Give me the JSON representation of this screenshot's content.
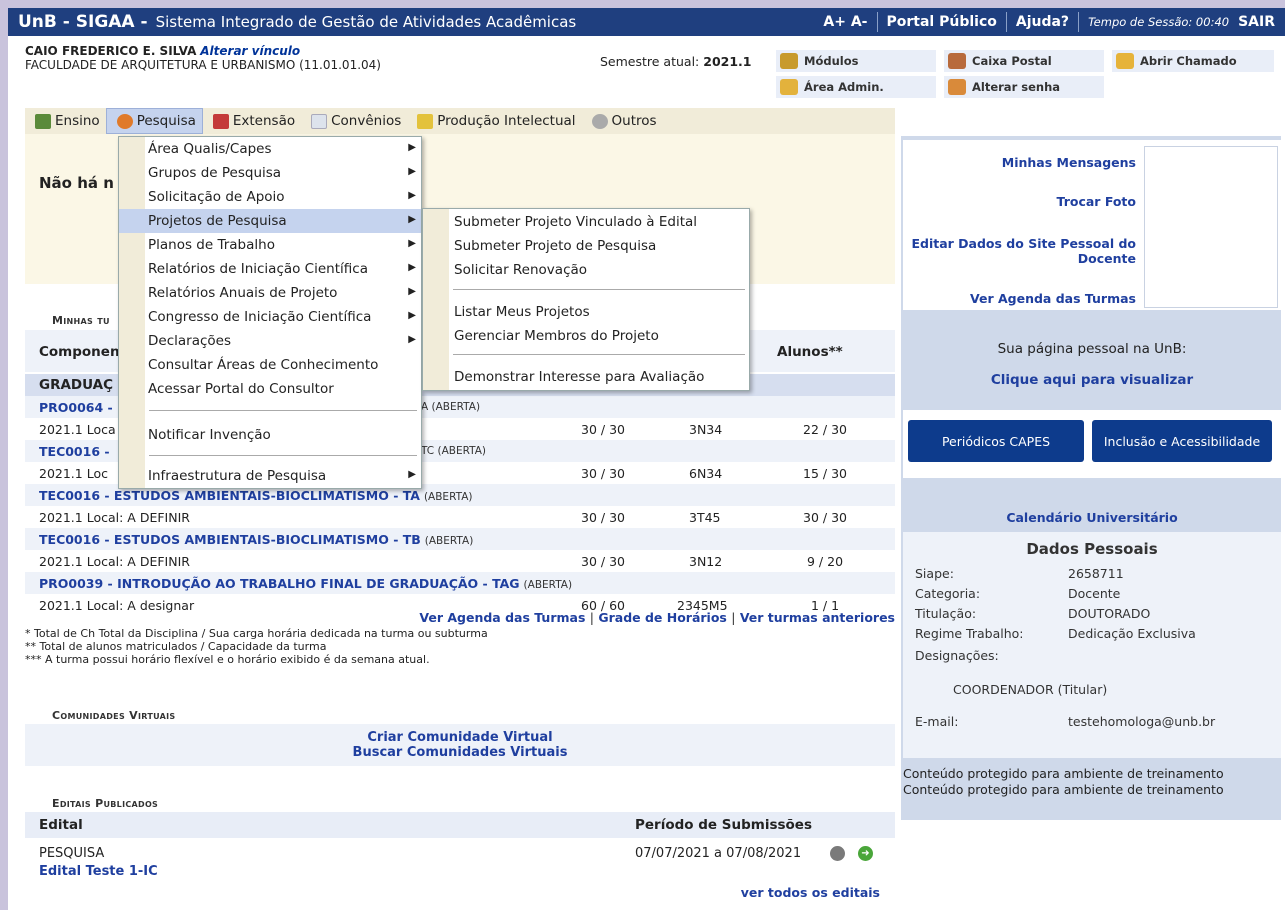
{
  "topbar": {
    "brand": "UnB - SIGAA -",
    "system_name": "Sistema Integrado de Gestão de Atividades Acadêmicas",
    "font_size": "A+ A-",
    "portal": "Portal Público",
    "help": "Ajuda?",
    "session_label": "Tempo de Sessão: 00:40",
    "logout": "SAIR"
  },
  "user": {
    "name": "CAIO FREDERICO E. SILVA",
    "change_link": "Alterar vínculo",
    "unit": "FACULDADE DE ARQUITETURA E URBANISMO (11.01.01.04)"
  },
  "semester": {
    "label": "Semestre atual:",
    "value": "2021.1"
  },
  "shortcuts": {
    "modulos": "Módulos",
    "caixa": "Caixa Postal",
    "chamado": "Abrir Chamado",
    "admin": "Área Admin.",
    "senha": "Alterar senha"
  },
  "menu": [
    "Ensino",
    "Pesquisa",
    "Extensão",
    "Convênios",
    "Produção Intelectual",
    "Outros"
  ],
  "dropdown": {
    "items": [
      "Área Qualis/Capes",
      "Grupos de Pesquisa",
      "Solicitação de Apoio",
      "Projetos de Pesquisa",
      "Planos de Trabalho",
      "Relatórios de Iniciação Científica",
      "Relatórios Anuais de Projeto",
      "Congresso de Iniciação Científica",
      "Declarações",
      "Consultar Áreas de Conhecimento",
      "Acessar Portal do Consultor",
      "Notificar Invenção",
      "Infraestrutura de Pesquisa"
    ],
    "submenu": [
      "Submeter Projeto Vinculado à Edital",
      "Submeter Projeto de Pesquisa",
      "Solicitar Renovação",
      "Listar Meus Projetos",
      "Gerenciar Membros do Projeto",
      "Demonstrar Interesse para Avaliação"
    ]
  },
  "notice": "Não há n",
  "turmas": {
    "title": "Minhas tu",
    "header_comp": "Componen",
    "header_alunos": "Alunos**",
    "group": "GRADUAÇ",
    "rows": [
      {
        "code": "PRO0064 -",
        "status": "A (ABERTA)",
        "local": "2021.1 Loca",
        "ch": "30 / 30",
        "hor": "3N34",
        "al": "22 / 30"
      },
      {
        "code": "TEC0016 -",
        "status": "TC (ABERTA)",
        "local": "2021.1 Loc",
        "ch": "30 / 30",
        "hor": "6N34",
        "al": "15 / 30"
      },
      {
        "code": "TEC0016 - ESTUDOS AMBIENTAIS-BIOCLIMATISMO - TA",
        "status": "(ABERTA)",
        "local": "2021.1 Local: A DEFINIR",
        "ch": "30 / 30",
        "hor": "3T45",
        "al": "30 / 30"
      },
      {
        "code": "TEC0016 - ESTUDOS AMBIENTAIS-BIOCLIMATISMO - TB",
        "status": "(ABERTA)",
        "local": "2021.1 Local: A DEFINIR",
        "ch": "30 / 30",
        "hor": "3N12",
        "al": "9 / 20"
      },
      {
        "code": "PRO0039 - INTRODUÇÃO AO TRABALHO FINAL DE GRADUAÇÃO - TAG",
        "status": "(ABERTA)",
        "local": "2021.1 Local: A designar",
        "ch": "60 / 60",
        "hor": "2345M5",
        "al": "1 / 1"
      }
    ],
    "links": [
      "Ver Agenda das Turmas",
      "Grade de Horários",
      "Ver turmas anteriores"
    ],
    "notes": [
      "* Total de Ch Total da Disciplina / Sua carga horária dedicada na turma ou subturma",
      "** Total de alunos matriculados / Capacidade da turma",
      "*** A turma possui horário flexível e o horário exibido é da semana atual."
    ]
  },
  "comunidades": {
    "title": "Comunidades Virtuais",
    "create": "Criar Comunidade Virtual",
    "search": "Buscar Comunidades Virtuais"
  },
  "editais": {
    "title": "Editais Publicados",
    "col_edital": "Edital",
    "col_periodo": "Período de Submissões",
    "item_type": "PESQUISA",
    "item_name": "Edital Teste 1-IC",
    "item_period": "07/07/2021 a 07/08/2021",
    "see_all": "ver todos os editais"
  },
  "side": {
    "mensagens": "Minhas Mensagens",
    "foto": "Trocar Foto",
    "site": "Editar Dados do Site Pessoal do Docente",
    "agenda": "Ver Agenda das Turmas",
    "personal_page": "Sua página pessoal na UnB:",
    "personal_link": "Clique aqui para visualizar",
    "capes": "Periódicos CAPES",
    "acess": "Inclusão e Acessibilidade",
    "calendario": "Calendário Universitário",
    "dados_title": "Dados Pessoais",
    "siape_l": "Siape:",
    "siape_v": "2658711",
    "cat_l": "Categoria:",
    "cat_v": "Docente",
    "tit_l": "Titulação:",
    "tit_v": "DOUTORADO",
    "reg_l": "Regime Trabalho:",
    "reg_v": "Dedicação Exclusiva",
    "des_l": "Designações:",
    "des_v": "COORDENADOR (Titular)",
    "email_l": "E-mail:",
    "email_v": "testehomologa@unb.br",
    "protect1": "Conteúdo protegido para ambiente de treinamento",
    "protect2": "Conteúdo protegido para ambiente de treinamento"
  }
}
